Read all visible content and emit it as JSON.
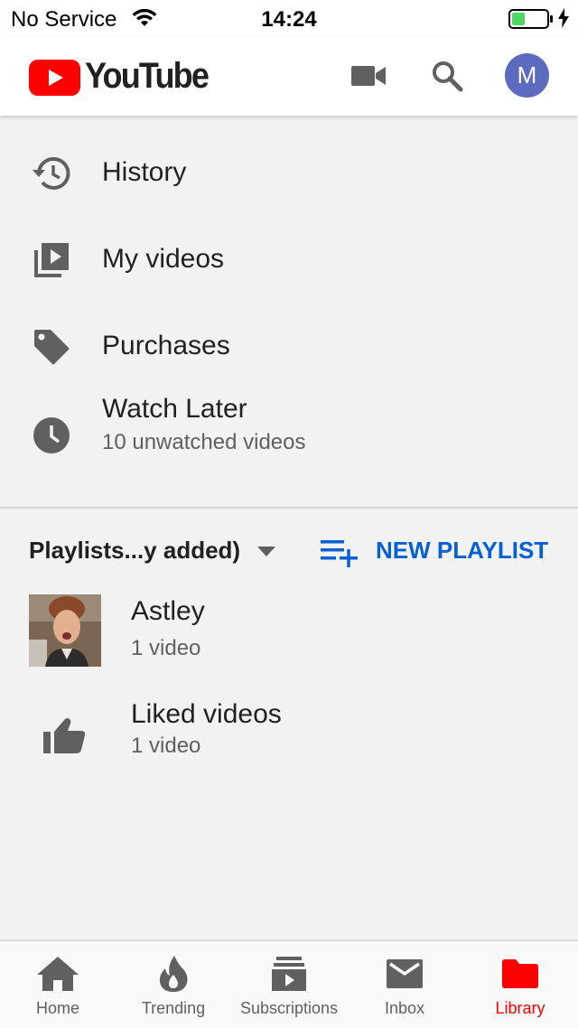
{
  "status_bar": {
    "carrier": "No Service",
    "time": "14:24",
    "battery_level": 0.35
  },
  "header": {
    "logo_text": "YouTube",
    "avatar_letter": "M",
    "avatar_color": "#5c6bc0",
    "brand_color": "#ff0000"
  },
  "menu": {
    "items": [
      {
        "label": "History",
        "icon": "history-icon"
      },
      {
        "label": "My videos",
        "icon": "my-videos-icon"
      },
      {
        "label": "Purchases",
        "icon": "tag-icon"
      },
      {
        "label": "Watch Later",
        "sublabel": "10 unwatched videos",
        "icon": "clock-icon"
      }
    ]
  },
  "playlists": {
    "sort_label": "Playlists...y added)",
    "new_playlist_label": "NEW PLAYLIST",
    "accent_color": "#065fd4",
    "items": [
      {
        "title": "Astley",
        "count": "1 video",
        "icon": "playlist-thumbnail"
      },
      {
        "title": "Liked videos",
        "count": "1 video",
        "icon": "thumbs-up-icon"
      }
    ]
  },
  "bottom_nav": {
    "items": [
      {
        "label": "Home",
        "icon": "home-icon",
        "active": false
      },
      {
        "label": "Trending",
        "icon": "flame-icon",
        "active": false
      },
      {
        "label": "Subscriptions",
        "icon": "subscriptions-icon",
        "active": false
      },
      {
        "label": "Inbox",
        "icon": "mail-icon",
        "active": false
      },
      {
        "label": "Library",
        "icon": "folder-icon",
        "active": true
      }
    ]
  }
}
